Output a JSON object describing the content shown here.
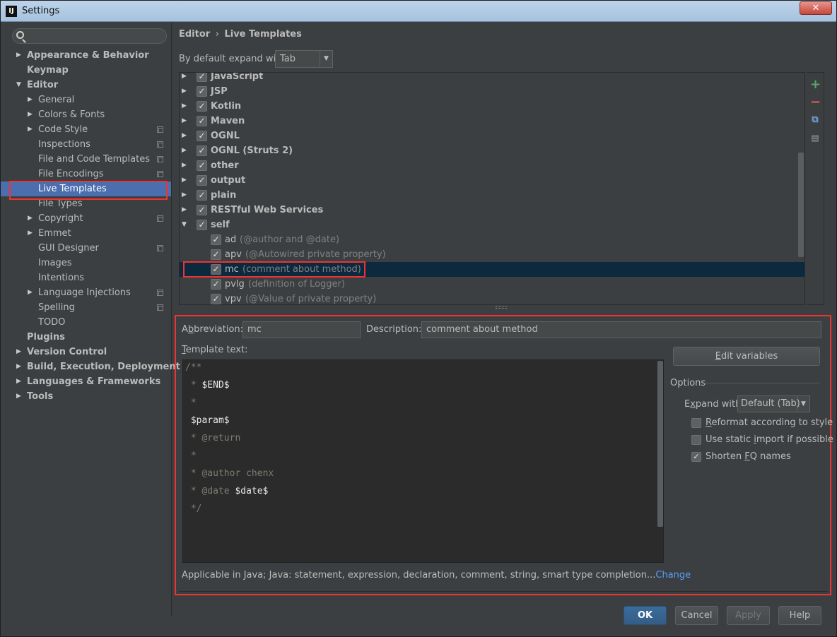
{
  "window": {
    "title": "Settings",
    "app_icon_text": "IJ",
    "close_glyph": "✕"
  },
  "search": {
    "placeholder": ""
  },
  "sidebar": {
    "items": [
      {
        "label": "Appearance & Behavior",
        "bold": true,
        "arrow": "▶",
        "level": 0
      },
      {
        "label": "Keymap",
        "bold": true,
        "arrow": "",
        "level": 0
      },
      {
        "label": "Editor",
        "bold": true,
        "arrow": "▼",
        "level": 0
      },
      {
        "label": "General",
        "arrow": "▶",
        "level": 1
      },
      {
        "label": "Colors & Fonts",
        "arrow": "▶",
        "level": 1
      },
      {
        "label": "Code Style",
        "arrow": "▶",
        "level": 1,
        "copy": true
      },
      {
        "label": "Inspections",
        "arrow": "",
        "level": 1,
        "copy": true
      },
      {
        "label": "File and Code Templates",
        "arrow": "",
        "level": 1,
        "copy": true
      },
      {
        "label": "File Encodings",
        "arrow": "",
        "level": 1,
        "copy": true
      },
      {
        "label": "Live Templates",
        "arrow": "",
        "level": 1,
        "selected": true
      },
      {
        "label": "File Types",
        "arrow": "",
        "level": 1
      },
      {
        "label": "Copyright",
        "arrow": "▶",
        "level": 1,
        "copy": true
      },
      {
        "label": "Emmet",
        "arrow": "▶",
        "level": 1
      },
      {
        "label": "GUI Designer",
        "arrow": "",
        "level": 1,
        "copy": true
      },
      {
        "label": "Images",
        "arrow": "",
        "level": 1
      },
      {
        "label": "Intentions",
        "arrow": "",
        "level": 1
      },
      {
        "label": "Language Injections",
        "arrow": "▶",
        "level": 1,
        "copy": true
      },
      {
        "label": "Spelling",
        "arrow": "",
        "level": 1,
        "copy": true
      },
      {
        "label": "TODO",
        "arrow": "",
        "level": 1
      },
      {
        "label": "Plugins",
        "bold": true,
        "arrow": "",
        "level": 0
      },
      {
        "label": "Version Control",
        "bold": true,
        "arrow": "▶",
        "level": 0
      },
      {
        "label": "Build, Execution, Deployment",
        "bold": true,
        "arrow": "▶",
        "level": 0
      },
      {
        "label": "Languages & Frameworks",
        "bold": true,
        "arrow": "▶",
        "level": 0
      },
      {
        "label": "Tools",
        "bold": true,
        "arrow": "▶",
        "level": 0
      }
    ]
  },
  "header": {
    "breadcrumb_parent": "Editor",
    "breadcrumb_sep": "›",
    "breadcrumb_current": "Live Templates"
  },
  "expand": {
    "label": "By default expand with",
    "value": "Tab",
    "arrow": "▼"
  },
  "templates": {
    "groups": [
      {
        "name": "JavaScript",
        "arrow": "▶",
        "checked": true
      },
      {
        "name": "JSP",
        "arrow": "▶",
        "checked": true
      },
      {
        "name": "Kotlin",
        "arrow": "▶",
        "checked": true
      },
      {
        "name": "Maven",
        "arrow": "▶",
        "checked": true
      },
      {
        "name": "OGNL",
        "arrow": "▶",
        "checked": true
      },
      {
        "name": "OGNL (Struts 2)",
        "arrow": "▶",
        "checked": true
      },
      {
        "name": "other",
        "arrow": "▶",
        "checked": true
      },
      {
        "name": "output",
        "arrow": "▶",
        "checked": true
      },
      {
        "name": "plain",
        "arrow": "▶",
        "checked": true
      },
      {
        "name": "RESTful Web Services",
        "arrow": "▶",
        "checked": true
      },
      {
        "name": "self",
        "arrow": "▼",
        "checked": true
      }
    ],
    "children": [
      {
        "abbr": "ad",
        "desc": "(@author and @date)",
        "checked": true
      },
      {
        "abbr": "apv",
        "desc": "(@Autowired private property)",
        "checked": true
      },
      {
        "abbr": "mc",
        "desc": "(comment about method)",
        "checked": true,
        "selected": true
      },
      {
        "abbr": "pvlg",
        "desc": "(definition of Logger)",
        "checked": true
      },
      {
        "abbr": "vpv",
        "desc": "(@Value of private property)",
        "checked": true
      }
    ],
    "tools": {
      "add": "+",
      "remove": "−",
      "copy": "⧉",
      "restore": "▤"
    }
  },
  "editor": {
    "abbreviation_label_pre": "A",
    "abbreviation_label_u": "b",
    "abbreviation_label_post": "breviation:",
    "abbreviation_value": "mc",
    "description_label": "Description:",
    "description_value": "comment about method",
    "template_text_label_u": "T",
    "template_text_label_post": "emplate text:",
    "template_lines": [
      [
        {
          "t": "/**",
          "c": "cmt"
        }
      ],
      [
        {
          "t": " * ",
          "c": "cmt"
        },
        {
          "t": "$END$",
          "c": "var"
        }
      ],
      [
        {
          "t": " *",
          "c": "cmt"
        }
      ],
      [
        {
          "t": " $param$",
          "c": "var"
        }
      ],
      [
        {
          "t": " * @return",
          "c": "cmt"
        }
      ],
      [
        {
          "t": " *",
          "c": "cmt"
        }
      ],
      [
        {
          "t": " * @author chenx",
          "c": "cmt"
        }
      ],
      [
        {
          "t": " * @date ",
          "c": "cmt"
        },
        {
          "t": "$date$",
          "c": "var"
        }
      ],
      [
        {
          "t": " */",
          "c": "cmt"
        }
      ]
    ],
    "edit_variables_u": "E",
    "edit_variables_post": "dit variables",
    "options_title": "Options",
    "expand_with_pre": "E",
    "expand_with_u": "x",
    "expand_with_post": "pand with",
    "expand_with_value": "Default (Tab)",
    "expand_arrow": "▼",
    "opt_reformat_u": "R",
    "opt_reformat_post": "eformat according to style",
    "opt_static_pre": "Use static ",
    "opt_static_u": "i",
    "opt_static_post": "mport if possible",
    "opt_shorten_pre": "Shorten ",
    "opt_shorten_u": "F",
    "opt_shorten_post": "Q names",
    "applicable_text": "Applicable in Java; Java: statement, expression, declaration, comment, string, smart type completion...",
    "change_link": "Change",
    "check_glyph": "✓"
  },
  "footer": {
    "ok": "OK",
    "cancel": "Cancel",
    "apply": "Apply",
    "help": "Help"
  }
}
